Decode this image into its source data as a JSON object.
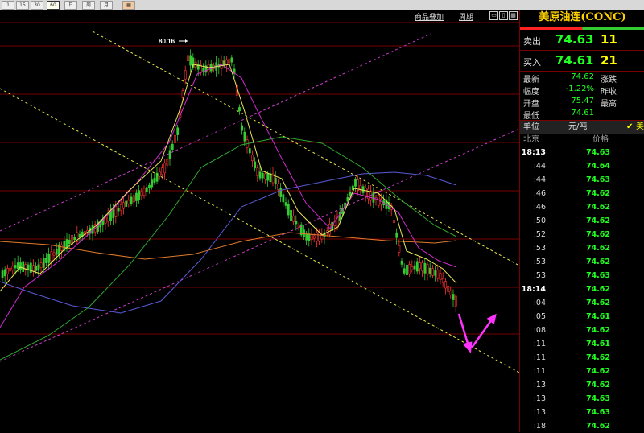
{
  "toolbar": {
    "buttons": [
      "1",
      "15",
      "30",
      "60",
      "日",
      "周",
      "月"
    ]
  },
  "chart_header": {
    "overlay_link": "商品叠加",
    "period_link": "周期"
  },
  "chart": {
    "high_label": "80.16"
  },
  "panel": {
    "title": "美原油连(CONC)",
    "ask": {
      "label": "卖出",
      "price": "74.63",
      "volume": "11"
    },
    "bid": {
      "label": "买入",
      "price": "74.61",
      "volume": "21"
    },
    "stats": [
      {
        "label": "最新",
        "value": "74.62",
        "label2": "涨跌"
      },
      {
        "label": "幅度",
        "value": "-1.22%",
        "label2": "昨收"
      },
      {
        "label": "开盘",
        "value": "75.47",
        "label2": "最高"
      },
      {
        "label": "最低",
        "value": "74.61",
        "label2": ""
      }
    ],
    "unit_label": "单位",
    "unit_value": "元/吨",
    "unit_extra": "美",
    "ticks_header": {
      "location": "北京",
      "price": "价格"
    },
    "ticks": [
      {
        "time": "18:13",
        "price": "74.63"
      },
      {
        "time": ":44",
        "price": "74.64"
      },
      {
        "time": ":44",
        "price": "74.63"
      },
      {
        "time": ":46",
        "price": "74.62"
      },
      {
        "time": ":46",
        "price": "74.62"
      },
      {
        "time": ":50",
        "price": "74.62"
      },
      {
        "time": ":52",
        "price": "74.62"
      },
      {
        "time": ":53",
        "price": "74.62"
      },
      {
        "time": ":53",
        "price": "74.62"
      },
      {
        "time": ":53",
        "price": "74.63"
      },
      {
        "time": "18:14",
        "price": "74.62"
      },
      {
        "time": ":04",
        "price": "74.62"
      },
      {
        "time": ":05",
        "price": "74.61"
      },
      {
        "time": ":08",
        "price": "74.62"
      },
      {
        "time": ":11",
        "price": "74.61"
      },
      {
        "time": ":11",
        "price": "74.62"
      },
      {
        "time": ":11",
        "price": "74.62"
      },
      {
        "time": ":13",
        "price": "74.62"
      },
      {
        "time": ":13",
        "price": "74.63"
      },
      {
        "time": ":13",
        "price": "74.63"
      },
      {
        "time": ":18",
        "price": "74.62"
      }
    ]
  },
  "colors": {
    "up": "#ff3333",
    "down": "#33cc33",
    "text_green": "#22ff22",
    "volume_yellow": "#ffff00",
    "title_gold": "#ffd200",
    "ma_yellow": "#e6e65a",
    "ma_magenta": "#d02ad0",
    "ma_green": "#2fa82f",
    "ma_orange": "#e07a2a",
    "ma_blue": "#5a5ad8",
    "arrow": "#ff33ff"
  }
}
